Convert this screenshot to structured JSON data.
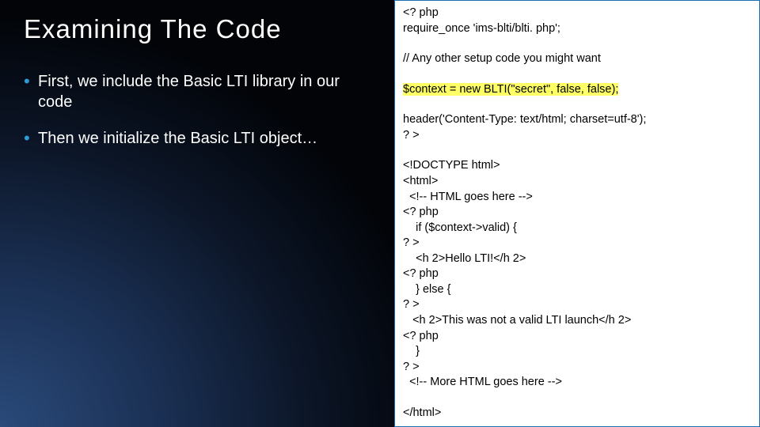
{
  "slide": {
    "title": "Examining The Code",
    "bullets": [
      "First, we include the Basic LTI library in our code",
      "Then we initialize the Basic LTI object…"
    ]
  },
  "code": {
    "lines": [
      "<? php",
      "require_once 'ims-blti/blti. php';",
      "",
      "// Any other setup code you might want",
      "",
      "$context = new BLTI(\"secret\", false, false);",
      "",
      "header('Content-Type: text/html; charset=utf-8');",
      "? >",
      "",
      "<!DOCTYPE html>",
      "<html>",
      "  <!-- HTML goes here -->",
      "<? php",
      "    if ($context->valid) {",
      "? >",
      "    <h 2>Hello LTI!</h 2>",
      "<? php",
      "    } else {",
      "? >",
      "   <h 2>This was not a valid LTI launch</h 2>",
      "<? php",
      "    }",
      "? >",
      "  <!-- More HTML goes here -->",
      "",
      "</html>"
    ],
    "highlight_index": 5
  }
}
